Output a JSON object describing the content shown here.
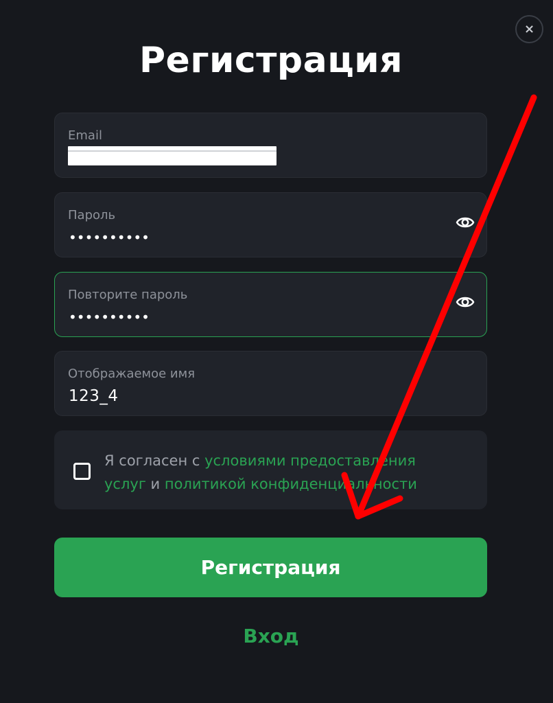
{
  "dialog": {
    "title": "Регистрация",
    "close_label": "×"
  },
  "fields": {
    "email": {
      "label": "Email",
      "value_redacted": true
    },
    "password": {
      "label": "Пароль",
      "value": "••••••••••"
    },
    "confirm_password": {
      "label": "Повторите пароль",
      "value": "••••••••••",
      "focused": true
    },
    "display_name": {
      "label": "Отображаемое имя",
      "value": "123_4"
    }
  },
  "agreement": {
    "checked": false,
    "prefix": "Я согласен с ",
    "terms_link": "условиями предоставления услуг",
    "middle": " и ",
    "privacy_link": "политикой конфиденциальности"
  },
  "actions": {
    "submit_label": "Регистрация",
    "login_label": "Вход"
  },
  "icons": {
    "password_toggle": "eye-icon",
    "confirm_toggle": "eye-icon",
    "close": "close-icon"
  },
  "colors": {
    "background": "#16181d",
    "field_bg": "#20232a",
    "accent": "#2aa353",
    "annotation_arrow": "#ff0000"
  }
}
